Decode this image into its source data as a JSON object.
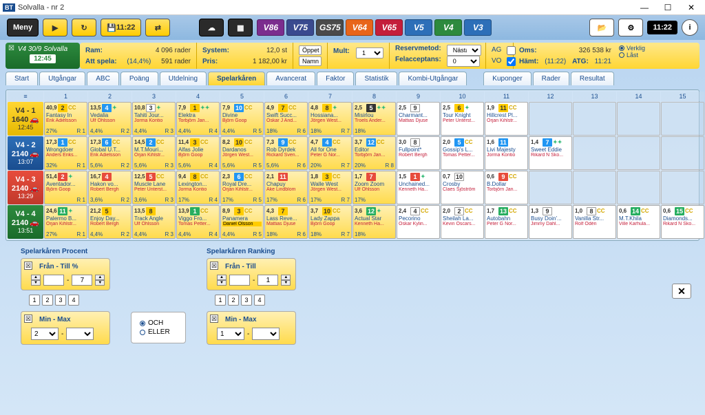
{
  "title": "Solvalla - nr 2",
  "app_prefix": "BT",
  "menu_label": "Meny",
  "clock": "11:22",
  "save_label": "11:22",
  "game_buttons": [
    "V86",
    "V75",
    "GS75",
    "V64",
    "V65",
    "V5",
    "V4",
    "V3"
  ],
  "race": {
    "code": "V4  30/9  Solvalla",
    "time": "12:45"
  },
  "info": {
    "ram_lbl": "Ram:",
    "ram_val": "4 096 rader",
    "att_lbl": "Att spela:",
    "att_pct": "(14,4%)",
    "att_val": "591 rader",
    "system_lbl": "System:",
    "system_val": "12,0 st",
    "pris_lbl": "Pris:",
    "pris_val": "1 182,00 kr",
    "btn_oppet": "Öppet",
    "btn_namn": "Namn",
    "mult_lbl": "Mult:",
    "mult_val": "1",
    "reserv_lbl": "Reservmetod:",
    "reserv_val": "Nästa",
    "fel_lbl": "Felacceptans:",
    "fel_val": "0",
    "ag_lbl": "AG",
    "vo_lbl": "VO",
    "oms_lbl": "Oms:",
    "oms_val": "326 538 kr",
    "hamt_lbl": "Hämt:",
    "hamt_val": "(11:22)",
    "atg_lbl": "ATG:",
    "atg_val": "11:21",
    "radio_verklig": "Verklig",
    "radio_last": "Låst"
  },
  "tabs": [
    "Start",
    "Utgångar",
    "ABC",
    "Poäng",
    "Utdelning",
    "Spelarkåren",
    "Avancerat",
    "Faktor",
    "Statistik",
    "Kombi-Utgångar",
    "Kuponger",
    "Rader",
    "Resultat"
  ],
  "active_tab": 5,
  "col_headers": [
    "1",
    "2",
    "3",
    "4",
    "5",
    "6",
    "7",
    "8",
    "9",
    "10",
    "11",
    "12",
    "13",
    "14",
    "15"
  ],
  "rows": [
    {
      "cls": "rh-yellow",
      "leg": "V4 - 1",
      "num": "1640",
      "time": "12:45",
      "car": "🚗",
      "cells": [
        {
          "rn": "40,9",
          "num": "2",
          "nb": "nb-y",
          "cc": "CC",
          "h": "Fantasy In",
          "d": "Erik Adielsson",
          "p": "27%",
          "r": "R 1"
        },
        {
          "rn": "13,5",
          "num": "4",
          "nb": "nb-b",
          "cc": "✦",
          "cc2": "cc-blue",
          "h": "Vedalia",
          "d": "Ulf Ohlsson",
          "p": "4,4%",
          "r": "R 2"
        },
        {
          "rn": "10,8",
          "num": "3",
          "nb": "nb-w",
          "cc": "✦",
          "cc2": "cc-blue",
          "h": "Tahiti Jour...",
          "d": "Jorma Kontio",
          "p": "4,4%",
          "r": "R 3"
        },
        {
          "rn": "7,9",
          "num": "1",
          "nb": "nb-y",
          "cc": "✦✦",
          "cc2": "cc-blue",
          "h": "Elektra",
          "d": "Torbjörn Jan...",
          "p": "4,4%",
          "r": "R 4"
        },
        {
          "rn": "7,9",
          "num": "10",
          "nb": "nb-b",
          "cc": "CC",
          "h": "Divine",
          "d": "Björn Goop",
          "p": "4,4%",
          "r": "R 5"
        },
        {
          "rn": "4,9",
          "num": "7",
          "nb": "nb-y",
          "cc": "CC",
          "h": "Swift Succ...",
          "d": "Oskar J And...",
          "p": "18%",
          "r": "R 6"
        },
        {
          "rn": "4,8",
          "num": "8",
          "nb": "nb-y",
          "cc": "✦",
          "cc2": "cc-blue",
          "h": "Hossiana...",
          "d": "Jörgen West...",
          "p": "18%",
          "r": "R 7"
        },
        {
          "rn": "2,5",
          "num": "5",
          "nb": "nb-bl",
          "cc": "✦✦",
          "cc2": "cc-blue",
          "h": "Misirlou",
          "d": "Troels Ander...",
          "p": "18%",
          "r": ""
        },
        {
          "rn": "2,5",
          "num": "9",
          "nb": "nb-w",
          "cc": "",
          "h": "Charmant...",
          "d": "Mattias Djuse",
          "p": "",
          "r": "",
          "white": true
        },
        {
          "rn": "2,5",
          "num": "6",
          "nb": "nb-y",
          "cc": "✦",
          "cc2": "cc-blue",
          "h": "Tour Knight",
          "d": "Peter Unterst...",
          "p": "",
          "r": "",
          "white": true
        },
        {
          "rn": "1,9",
          "num": "11",
          "nb": "nb-y",
          "cc": "CC",
          "h": "Hillcrest Pl...",
          "d": "Örjan Kihlstr...",
          "p": "",
          "r": "",
          "white": true
        },
        {
          "empty": true
        },
        {
          "empty": true
        },
        {
          "empty": true
        },
        {
          "empty": true
        }
      ]
    },
    {
      "cls": "rh-blue",
      "leg": "V4 - 2",
      "num": "2140",
      "time": "13:07",
      "car": "🚗",
      "cells": [
        {
          "rn": "17,3",
          "num": "1",
          "nb": "nb-b",
          "cc": "CC",
          "h": "Wrongdoer",
          "d": "Anders Eriks...",
          "p": "32%",
          "r": "R 1"
        },
        {
          "rn": "17,3",
          "num": "6",
          "nb": "nb-b",
          "cc": "CC",
          "h": "Global U.T...",
          "d": "Erik Adielsson",
          "p": "5,6%",
          "r": "R 2"
        },
        {
          "rn": "14,5",
          "num": "2",
          "nb": "nb-b",
          "cc": "CC",
          "h": "M.T.Mouri...",
          "d": "Örjan Kihlstr...",
          "p": "5,6%",
          "r": "R 3"
        },
        {
          "rn": "11,4",
          "num": "3",
          "nb": "nb-y",
          "cc": "CC",
          "h": "Alfas Jolie",
          "d": "Björn Goop",
          "p": "5,6%",
          "r": "R 4"
        },
        {
          "rn": "8,2",
          "num": "10",
          "nb": "nb-y",
          "cc": "CC",
          "h": "Dardanos",
          "d": "Jörgen West...",
          "p": "5,6%",
          "r": "R 5"
        },
        {
          "rn": "7,3",
          "num": "9",
          "nb": "nb-b",
          "cc": "CC",
          "h": "Rob Dyrdek",
          "d": "Rickard Sven...",
          "p": "5,6%",
          "r": "R 6"
        },
        {
          "rn": "4,7",
          "num": "4",
          "nb": "nb-b",
          "cc": "CC",
          "h": "All for One",
          "d": "Peter G Nor...",
          "p": "20%",
          "r": "R 7"
        },
        {
          "rn": "3,7",
          "num": "12",
          "nb": "nb-b",
          "cc": "CC",
          "h": "Editor",
          "d": "Torbjörn Jan...",
          "p": "20%",
          "r": "R 8"
        },
        {
          "rn": "3,0",
          "num": "8",
          "nb": "nb-w",
          "cc": "",
          "h": "Fullpoint*",
          "d": "Robert Bergh",
          "p": "",
          "r": "",
          "white": true
        },
        {
          "rn": "2,0",
          "num": "5",
          "nb": "nb-b",
          "cc": "CC",
          "h": "Gossip's L...",
          "d": "Tomas Petter...",
          "p": "",
          "r": "",
          "white": true
        },
        {
          "rn": "1,6",
          "num": "11",
          "nb": "nb-b",
          "cc": "",
          "h": "Livi Majesty",
          "d": "Jorma Kontio",
          "p": "",
          "r": "",
          "white": true
        },
        {
          "rn": "1,4",
          "num": "7",
          "nb": "nb-b",
          "cc": "✦✦",
          "cc2": "cc-blue",
          "h": "Sweet Eddie",
          "d": "Rikard N Sko...",
          "p": "",
          "r": "",
          "white": true
        },
        {
          "empty": true
        },
        {
          "empty": true
        },
        {
          "empty": true
        }
      ]
    },
    {
      "cls": "rh-red",
      "leg": "V4 - 3",
      "num": "2140",
      "time": "13:29",
      "car": "🚗",
      "cells": [
        {
          "rn": "51,4",
          "num": "2",
          "nb": "nb-r",
          "cc": "✦",
          "cc2": "cc-blue",
          "h": "Aventador...",
          "d": "Björn Goop",
          "p": "",
          "r": "R 1"
        },
        {
          "rn": "16,7",
          "num": "4",
          "nb": "nb-r",
          "cc": "",
          "h": "Hakon vo...",
          "d": "Robert Bergh",
          "p": "3,6%",
          "r": "R 2"
        },
        {
          "rn": "12,5",
          "num": "5",
          "nb": "nb-r",
          "cc": "CC",
          "h": "Muscle Lane",
          "d": "Peter Unterst...",
          "p": "3,6%",
          "r": "R 3"
        },
        {
          "rn": "9,4",
          "num": "8",
          "nb": "nb-y",
          "cc": "CC",
          "h": "Lexington...",
          "d": "Jorma Kontio",
          "p": "17%",
          "r": "R 4"
        },
        {
          "rn": "2,3",
          "num": "6",
          "nb": "nb-b",
          "cc": "CC",
          "h": "Royal Dre...",
          "d": "Örjan Kihlstr...",
          "p": "17%",
          "r": "R 5"
        },
        {
          "rn": "2,1",
          "num": "11",
          "nb": "nb-r",
          "cc": "",
          "h": "Chapuy",
          "d": "Åke Lindblom",
          "p": "17%",
          "r": "R 6"
        },
        {
          "rn": "1,8",
          "num": "3",
          "nb": "nb-y",
          "cc": "CC",
          "h": "Walle West",
          "d": "Jörgen West...",
          "p": "17%",
          "r": "R 7"
        },
        {
          "rn": "1,7",
          "num": "7",
          "nb": "nb-r",
          "cc": "",
          "h": "Zoom Zoom",
          "d": "Ulf Ohlsson",
          "p": "17%",
          "r": ""
        },
        {
          "rn": "1,5",
          "num": "1",
          "nb": "nb-r",
          "cc": "✦",
          "cc2": "cc-blue",
          "h": "Unchained...",
          "d": "Kenneth Ha...",
          "p": "",
          "r": "",
          "white": true
        },
        {
          "rn": "0,7",
          "num": "10",
          "nb": "nb-w",
          "cc": "",
          "h": "Crosby",
          "d": "Claes Sjöström",
          "p": "",
          "r": "",
          "white": true
        },
        {
          "rn": "0,6",
          "num": "9",
          "nb": "nb-r",
          "cc": "CC",
          "h": "B.Dollar",
          "d": "Torbjörn Jan...",
          "p": "",
          "r": "",
          "white": true
        },
        {
          "empty": true
        },
        {
          "empty": true
        },
        {
          "empty": true
        },
        {
          "empty": true
        }
      ]
    },
    {
      "cls": "rh-green",
      "leg": "V4 - 4",
      "num": "2140",
      "time": "13:51",
      "car": "🚗",
      "cells": [
        {
          "rn": "24,6",
          "num": "11",
          "nb": "nb-g",
          "cc": "✦",
          "cc2": "cc-blue",
          "h": "Palermo B...",
          "d": "Örjan Kihlstr...",
          "p": "27%",
          "r": "R 1"
        },
        {
          "rn": "21,2",
          "num": "5",
          "nb": "nb-y",
          "cc": "",
          "h": "Enjoy Day...",
          "d": "Robert Bergh",
          "p": "4,4%",
          "r": "R 2"
        },
        {
          "rn": "13,5",
          "num": "8",
          "nb": "nb-y",
          "cc": "",
          "h": "Track Angle",
          "d": "Ulf Ohlsson",
          "p": "4,4%",
          "r": "R 3"
        },
        {
          "rn": "13,9",
          "num": "1",
          "nb": "nb-g",
          "cc": "CC",
          "h": "Viggo Fro...",
          "d": "Tomas Petter...",
          "p": "4,4%",
          "r": "R 4"
        },
        {
          "rn": "8,9",
          "num": "3",
          "nb": "nb-y",
          "cc": "CC",
          "h": "Panamera",
          "d": "Daniel Olsson",
          "dhl": true,
          "p": "4,4%",
          "r": "R 5"
        },
        {
          "rn": "4,3",
          "num": "7",
          "nb": "nb-y",
          "cc": "",
          "h": "Lass Reve...",
          "d": "Mattias Djuse",
          "p": "18%",
          "r": "R 6"
        },
        {
          "rn": "3,7",
          "num": "10",
          "nb": "nb-y",
          "cc": "CC",
          "h": "Lady Zappa",
          "d": "Björn Goop",
          "p": "18%",
          "r": "R 7"
        },
        {
          "rn": "3,6",
          "num": "12",
          "nb": "nb-g",
          "cc": "✦",
          "cc2": "cc-blue",
          "h": "Actual Star",
          "d": "Kenneth Ha...",
          "p": "18%",
          "r": ""
        },
        {
          "rn": "2,4",
          "num": "4",
          "nb": "nb-w",
          "cc": "CC",
          "h": "Pecorino",
          "d": "Oskar Kylin...",
          "p": "",
          "r": "",
          "white": true
        },
        {
          "rn": "2,0",
          "num": "2",
          "nb": "nb-w",
          "cc": "CC",
          "h": "Sheilah La...",
          "d": "Kevin Oscars...",
          "p": "",
          "r": "",
          "white": true
        },
        {
          "rn": "1,7",
          "num": "13",
          "nb": "nb-g",
          "cc": "CC",
          "h": "Autobahn",
          "d": "Peter G Nor...",
          "p": "",
          "r": "",
          "white": true
        },
        {
          "rn": "1,3",
          "num": "9",
          "nb": "nb-w",
          "cc": "",
          "h": "Busy Doin'...",
          "d": "Jimmy Dahl...",
          "p": "",
          "r": "",
          "white": true
        },
        {
          "rn": "1,0",
          "num": "8",
          "nb": "nb-w",
          "cc": "CC",
          "h": "Vanilla Str...",
          "d": "Rolf Odén",
          "p": "",
          "r": "",
          "white": true
        },
        {
          "rn": "0,6",
          "num": "14",
          "nb": "nb-g",
          "cc": "CC",
          "h": "M.T.Khila",
          "d": "Ville Karhula...",
          "p": "",
          "r": "",
          "white": true
        },
        {
          "rn": "0,6",
          "num": "15",
          "nb": "nb-g",
          "cc": "CC",
          "h": "Diamonds...",
          "d": "Rikard N Sko...",
          "p": "",
          "r": "",
          "white": true
        }
      ]
    }
  ],
  "filters": {
    "f1_title": "Spelarkåren Procent",
    "f1_lbl": "Från - Till %",
    "f1_from": "",
    "f1_to": "7",
    "f2_title": "Spelarkåren Ranking",
    "f2_lbl": "Från - Till",
    "f2_from": "",
    "f2_to": "1",
    "legs": [
      "1",
      "2",
      "3",
      "4"
    ],
    "minmax_lbl": "Min - Max",
    "mm1_min": "2",
    "mm2_min": "1",
    "och": "OCH",
    "eller": "ELLER"
  }
}
